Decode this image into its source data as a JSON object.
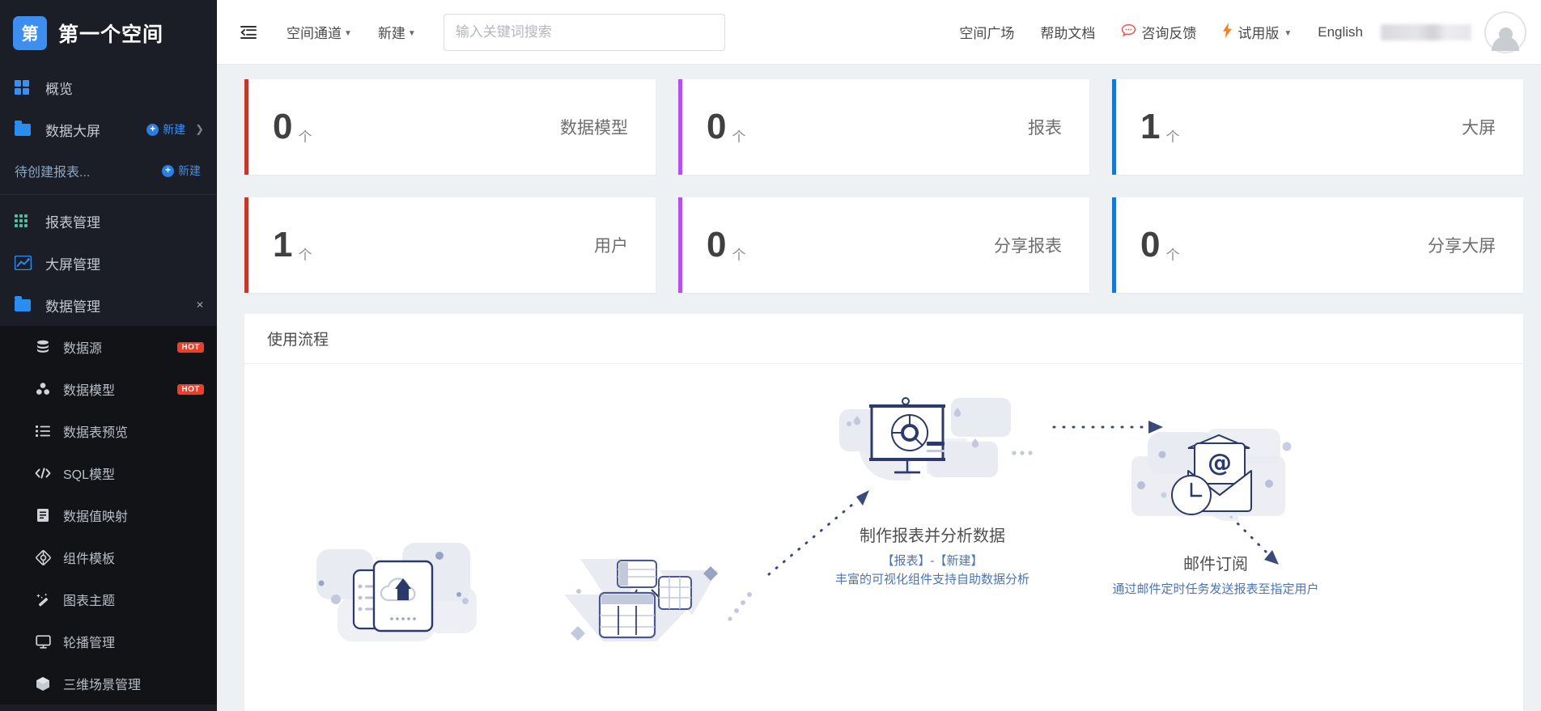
{
  "sidebar": {
    "logo_text": "第",
    "brand_title": "第一个空间",
    "overview_label": "概览",
    "dashboard_label": "数据大屏",
    "dashboard_new_label": "新建",
    "pending_label": "待创建报表...",
    "pending_new_label": "新建",
    "groups": [
      {
        "label": "报表管理",
        "icon": "grid-green-icon"
      },
      {
        "label": "大屏管理",
        "icon": "chart-line-icon"
      },
      {
        "label": "数据管理",
        "icon": "folder-icon"
      }
    ],
    "submenu": [
      {
        "label": "数据源",
        "icon": "database-icon",
        "badge": "HOT"
      },
      {
        "label": "数据模型",
        "icon": "model-icon",
        "badge": "HOT"
      },
      {
        "label": "数据表预览",
        "icon": "list-icon",
        "badge": ""
      },
      {
        "label": "SQL模型",
        "icon": "code-icon",
        "badge": ""
      },
      {
        "label": "数据值映射",
        "icon": "book-icon",
        "badge": ""
      },
      {
        "label": "组件模板",
        "icon": "cube-outline-icon",
        "badge": ""
      },
      {
        "label": "图表主题",
        "icon": "magic-wand-icon",
        "badge": ""
      },
      {
        "label": "轮播管理",
        "icon": "monitor-icon",
        "badge": ""
      },
      {
        "label": "三维场景管理",
        "icon": "cube-3d-icon",
        "badge": ""
      }
    ]
  },
  "topbar": {
    "collapse_icon": "collapse-sidebar-icon",
    "menu": [
      {
        "label": "空间通道",
        "has_caret": true
      },
      {
        "label": "新建",
        "has_caret": true
      }
    ],
    "search_placeholder": "输入关键词搜索",
    "search_value": "",
    "right_items": [
      {
        "label": "空间广场",
        "icon": ""
      },
      {
        "label": "帮助文档",
        "icon": ""
      },
      {
        "label": "咨询反馈",
        "icon": "chat-bubble-icon"
      },
      {
        "label": "试用版",
        "icon": "bolt-icon",
        "caret": true
      },
      {
        "label": "English",
        "icon": ""
      }
    ],
    "username_masked": ""
  },
  "stats": [
    {
      "value": "0",
      "unit": "个",
      "name": "数据模型",
      "color": "#c0392b"
    },
    {
      "value": "0",
      "unit": "个",
      "name": "报表",
      "color": "#b550e8"
    },
    {
      "value": "1",
      "unit": "个",
      "name": "大屏",
      "color": "#1878cf"
    },
    {
      "value": "1",
      "unit": "个",
      "name": "用户",
      "color": "#c0392b"
    },
    {
      "value": "0",
      "unit": "个",
      "name": "分享报表",
      "color": "#b550e8"
    },
    {
      "value": "0",
      "unit": "个",
      "name": "分享大屏",
      "color": "#1878cf"
    }
  ],
  "flow": {
    "title": "使用流程",
    "steps": [
      {
        "title": "",
        "desc_line1": "",
        "desc_line2": "",
        "art": "cloud-upload-illustration"
      },
      {
        "title": "",
        "desc_line1": "",
        "desc_line2": "",
        "art": "data-tables-illustration"
      },
      {
        "title": "制作报表并分析数据",
        "desc_line1": "【报表】-【新建】",
        "desc_line2": "丰富的可视化组件支持自助数据分析",
        "art": "presentation-chart-illustration"
      },
      {
        "title": "邮件订阅",
        "desc_line1": "通过邮件定时任务发送报表至指定用户",
        "desc_line2": "",
        "art": "email-clock-illustration"
      }
    ]
  },
  "colors": {
    "brand_blue": "#3c8ef0",
    "sidebar_bg": "#1b1e26",
    "submenu_bg": "#111317",
    "hot_red": "#e8402a",
    "link_blue": "#4b75b5",
    "illus_navy": "#2b3a6b"
  }
}
